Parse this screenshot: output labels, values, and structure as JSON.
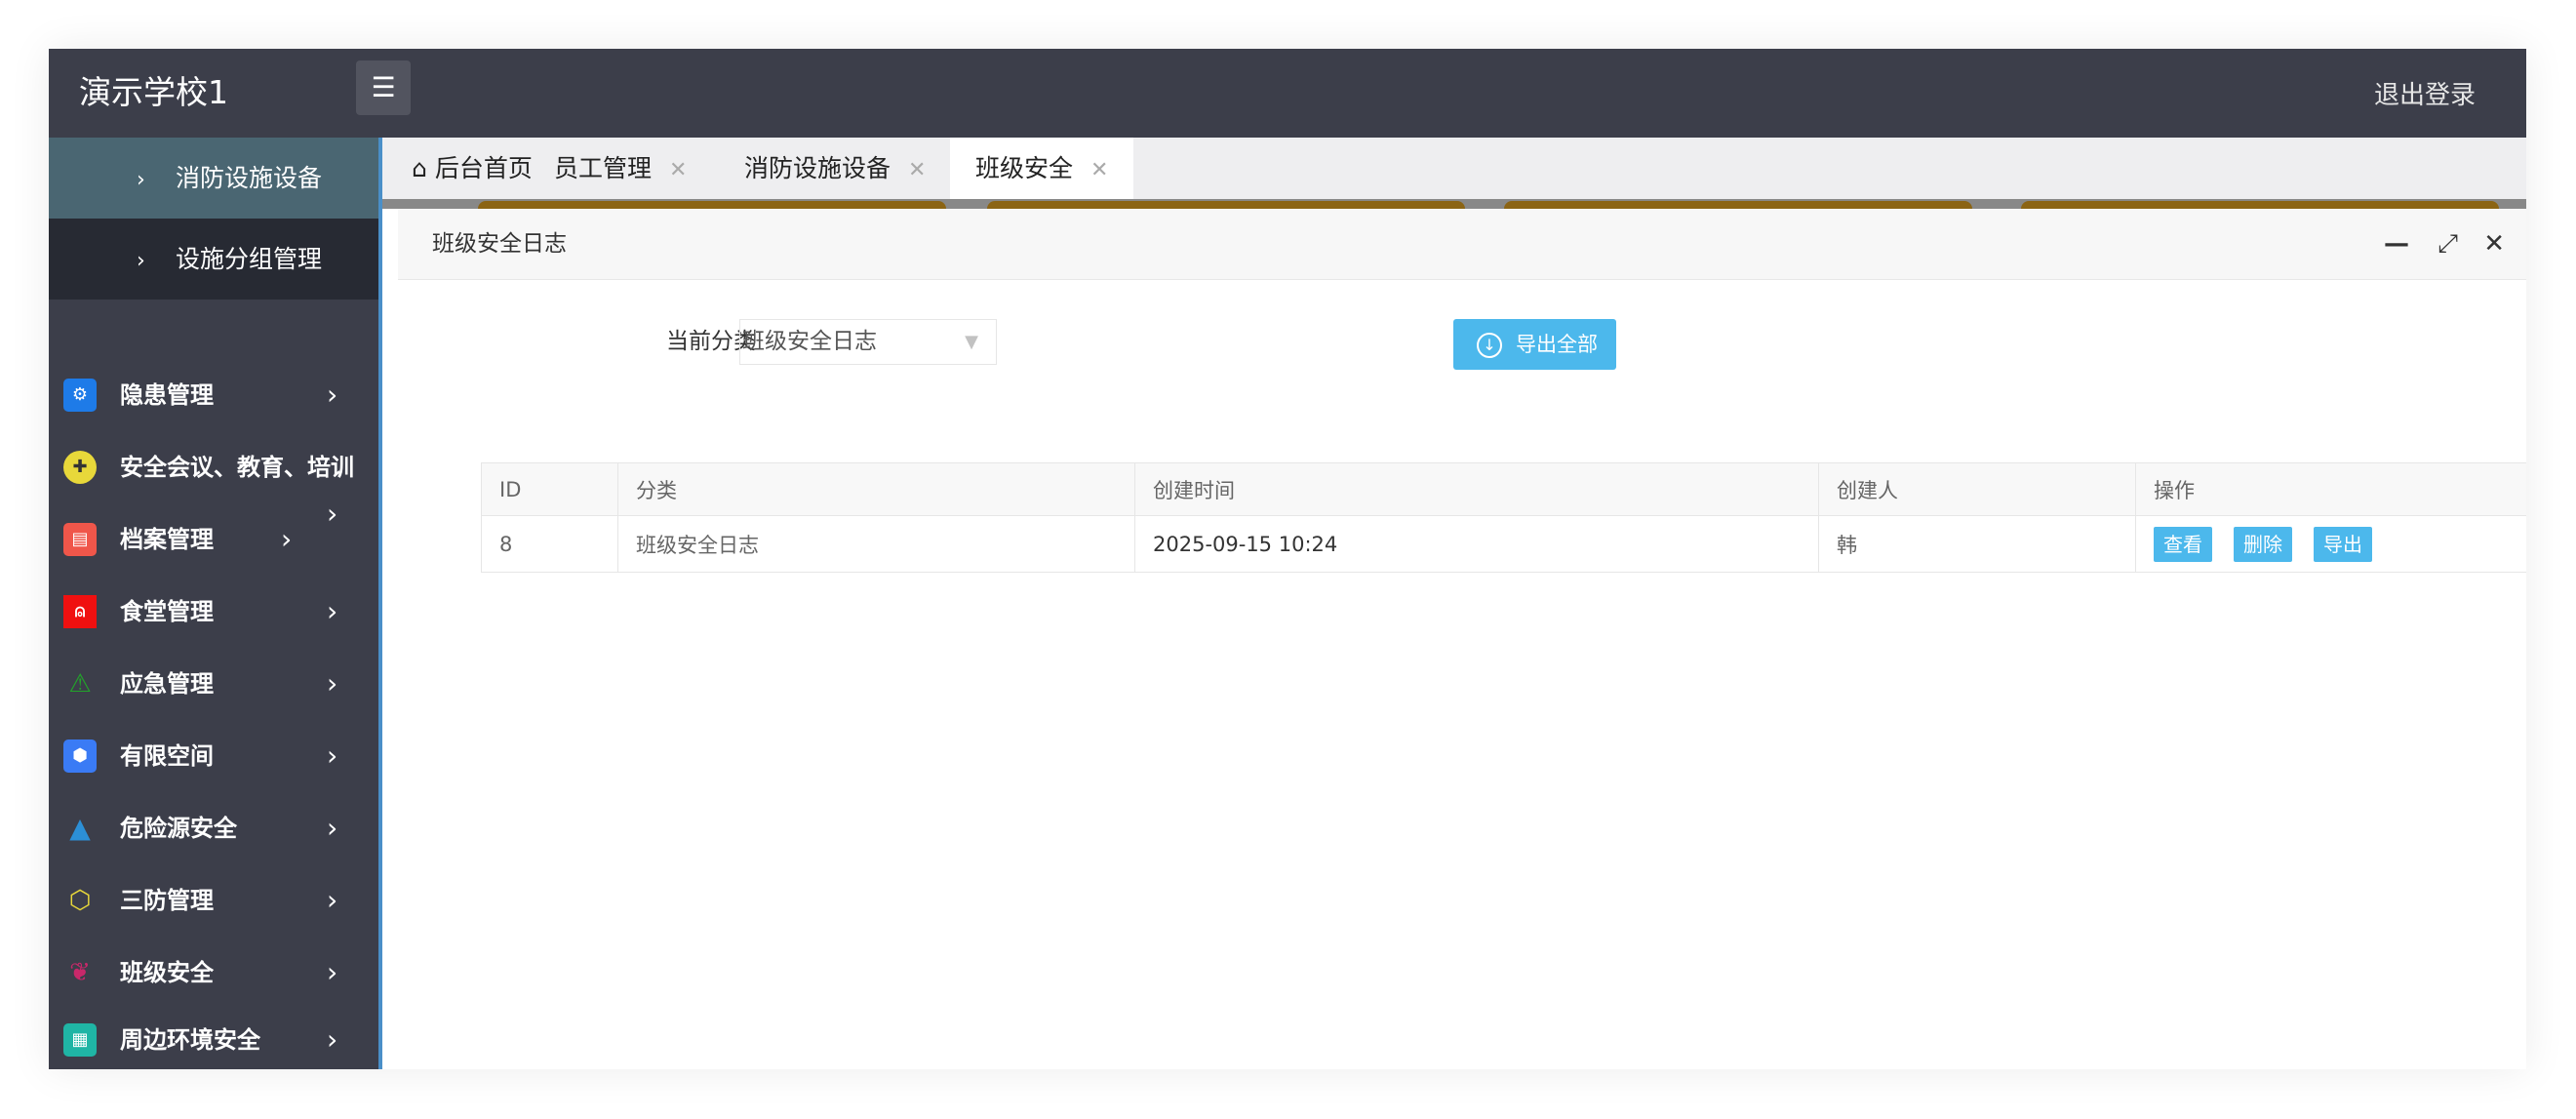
{
  "header": {
    "brand": "演示学校1",
    "logout": "退出登录"
  },
  "sidebar": {
    "sub_items": [
      {
        "label": "消防设施设备",
        "active": true
      },
      {
        "label": "设施分组管理"
      }
    ],
    "items": [
      {
        "label": "隐患管理",
        "icon": "shield-gear-icon",
        "color": "#1e7be8"
      },
      {
        "label": "安全会议、教育、培训",
        "icon": "meeting-icon",
        "color": "#e8d83a"
      },
      {
        "label": "档案管理",
        "icon": "archive-icon",
        "color": "#f0564a"
      },
      {
        "label": "食堂管理",
        "icon": "bell-icon",
        "color": "#f01010"
      },
      {
        "label": "应急管理",
        "icon": "warning-icon",
        "color": "#22a32a"
      },
      {
        "label": "有限空间",
        "icon": "cube-icon",
        "color": "#3a7bf5"
      },
      {
        "label": "危险源安全",
        "icon": "lightning-icon",
        "color": "#2c8fd6"
      },
      {
        "label": "三防管理",
        "icon": "hexagon-icon",
        "color": "#e8d83a"
      },
      {
        "label": "班级安全",
        "icon": "leaf-icon",
        "color": "#c8286a"
      },
      {
        "label": "周边环境安全",
        "icon": "map-icon",
        "color": "#1fb5a5"
      }
    ]
  },
  "tabs": [
    {
      "label": "后台首页",
      "icon": "home-icon"
    },
    {
      "label": "员工管理"
    },
    {
      "label": "消防设施设备"
    },
    {
      "label": "班级安全",
      "active": true
    }
  ],
  "panel": {
    "title": "班级安全日志",
    "filter_label": "当前分类",
    "category": "班级安全日志",
    "export_all": "导出全部",
    "table": {
      "headers": [
        "ID",
        "分类",
        "创建时间",
        "创建人",
        "操作"
      ],
      "rows": [
        {
          "id": "8",
          "category": "班级安全日志",
          "created": "2025-09-15 10:24",
          "creator": "韩",
          "actions": [
            "查看",
            "删除",
            "导出"
          ]
        }
      ]
    }
  },
  "colors": {
    "header": "#3c3e4a",
    "accent": "#4cb8ec",
    "active_sub": "#4a6672"
  }
}
